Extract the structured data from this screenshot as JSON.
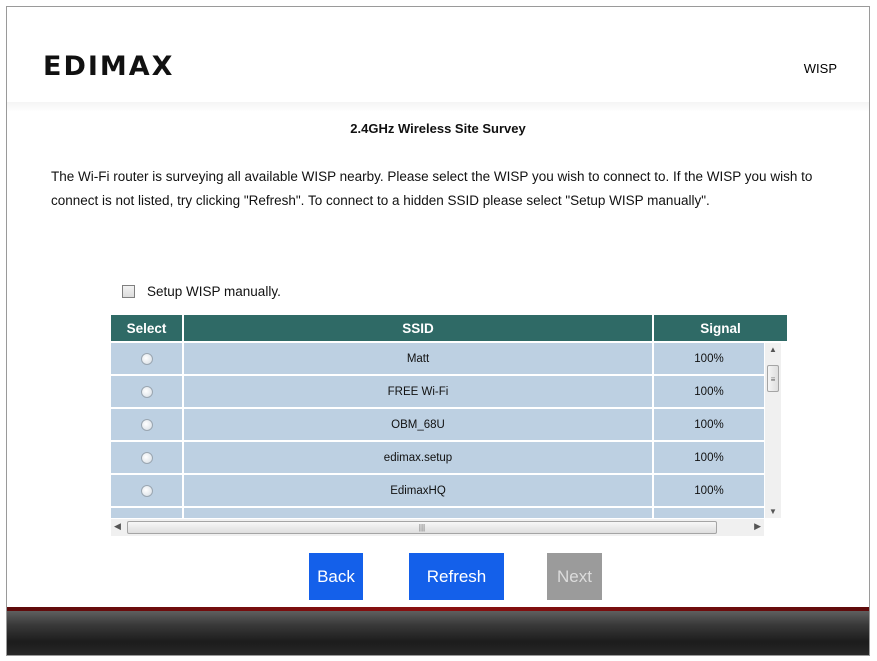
{
  "header": {
    "logo_text": "EDIMAX",
    "mode": "WISP"
  },
  "page": {
    "title": "2.4GHz Wireless Site Survey",
    "description": "The Wi-Fi router is surveying all available WISP nearby. Please select the WISP you wish to connect to. If the WISP you wish to connect is not listed, try clicking \"Refresh\". To connect to a hidden SSID please select \"Setup WISP manually\".",
    "manual_label": "Setup WISP manually.",
    "manual_checked": false
  },
  "table": {
    "columns": [
      "Select",
      "SSID",
      "Signal"
    ],
    "rows": [
      {
        "ssid": "Matt",
        "signal": "100%"
      },
      {
        "ssid": "FREE Wi-Fi",
        "signal": "100%"
      },
      {
        "ssid": "OBM_68U",
        "signal": "100%"
      },
      {
        "ssid": "edimax.setup",
        "signal": "100%"
      },
      {
        "ssid": "EdimaxHQ",
        "signal": "100%"
      }
    ]
  },
  "buttons": {
    "back": "Back",
    "refresh": "Refresh",
    "next": "Next"
  },
  "colors": {
    "header_bg": "#2f6a66",
    "row_bg": "#bdd0e2",
    "button_active": "#1460ea",
    "button_disabled": "#9b9b9b"
  }
}
